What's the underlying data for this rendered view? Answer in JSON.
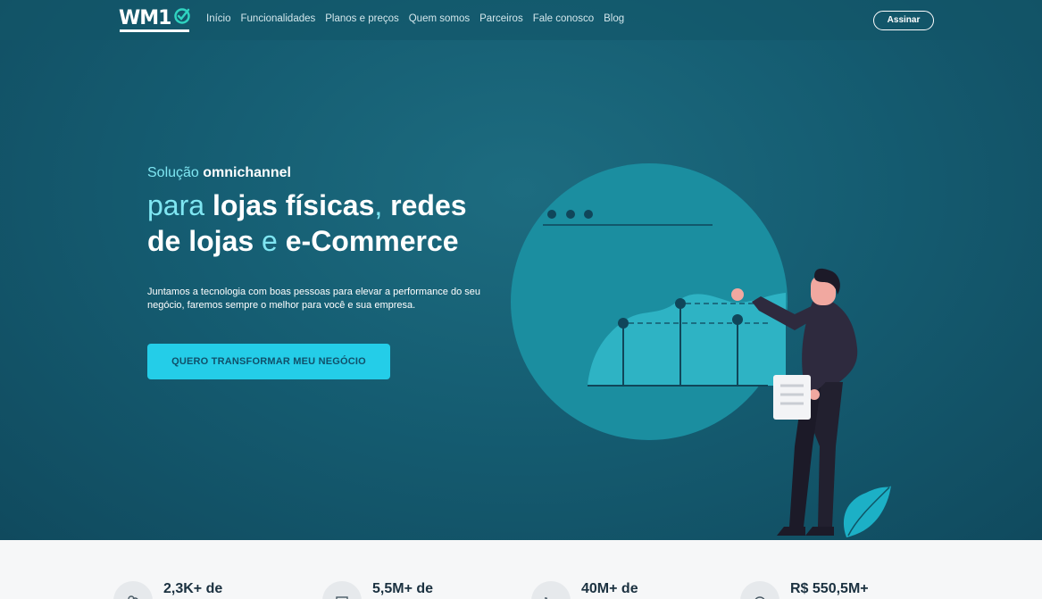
{
  "nav": {
    "logo_text": "WM1",
    "logo_check": "0",
    "menu": [
      "Início",
      "Funcionalidades",
      "Planos e preços",
      "Quem somos",
      "Parceiros",
      "Fale conosco",
      "Blog"
    ],
    "subscribe_label": "Assinar"
  },
  "hero": {
    "eyebrow_light": "Solução ",
    "eyebrow_bold": "omnichannel",
    "headline": {
      "p1": "para ",
      "p2": "lojas físicas",
      "p3": ", ",
      "p4": "redes",
      "p5": "de lojas",
      "p6": " e ",
      "p7": "e-Commerce"
    },
    "description": "Juntamos a tecnologia com boas pessoas para elevar a performance do seu negócio, faremos sempre o melhor para você e sua empresa.",
    "cta_label": "QUERO TRANSFORMAR MEU NEGÓCIO"
  },
  "stats": [
    {
      "value": "2,3K+ de",
      "icon": "users-icon"
    },
    {
      "value": "5,5M+ de",
      "icon": "document-icon"
    },
    {
      "value": "40M+ de",
      "icon": "cart-icon"
    },
    {
      "value": "R$ 550,5M+",
      "icon": "money-icon"
    }
  ],
  "colors": {
    "hero_bg": "#155d72",
    "accent": "#24cde8",
    "accent_text": "#7fe6f2",
    "logo_accent": "#2fd3c0"
  }
}
